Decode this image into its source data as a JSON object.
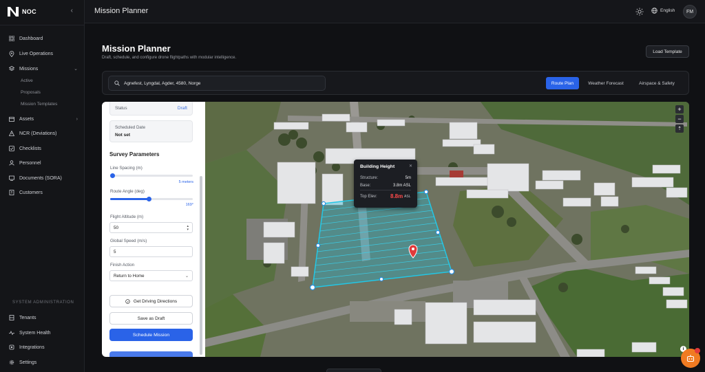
{
  "brand": {
    "name": "NOC"
  },
  "sidebar": {
    "items": [
      {
        "label": "Dashboard",
        "icon": "grid-icon"
      },
      {
        "label": "Live Operations",
        "icon": "map-pin-icon"
      },
      {
        "label": "Missions",
        "icon": "layers-icon"
      },
      {
        "label": "Assets",
        "icon": "box-icon"
      },
      {
        "label": "NCR (Deviations)",
        "icon": "alert-icon"
      },
      {
        "label": "Checklists",
        "icon": "checklist-icon"
      },
      {
        "label": "Personnel",
        "icon": "user-icon"
      },
      {
        "label": "Documents (SORA)",
        "icon": "document-icon"
      },
      {
        "label": "Customers",
        "icon": "building-icon"
      }
    ],
    "missions_sub": [
      "Active",
      "Proposals",
      "Mission Templates"
    ],
    "admin_title": "SYSTEM ADMINISTRATION",
    "admin_items": [
      {
        "label": "Tenants",
        "icon": "tenants-icon"
      },
      {
        "label": "System Health",
        "icon": "pulse-icon"
      },
      {
        "label": "Integrations",
        "icon": "plug-icon"
      },
      {
        "label": "Settings",
        "icon": "gear-icon"
      }
    ]
  },
  "topbar": {
    "title": "Mission Planner",
    "language": "English",
    "avatar": "FM"
  },
  "page": {
    "title": "Mission Planner",
    "subtitle": "Draft, schedule, and configure drone flightpaths with modular intelligence.",
    "load_template": "Load Template"
  },
  "search": {
    "value": "Agnefest, Lyngdal, Agder, 4580, Norge"
  },
  "tabs": [
    "Route Plan",
    "Weather Forecast",
    "Airspace & Safety"
  ],
  "panel": {
    "status_label": "Status",
    "status_value": "Draft",
    "scheduled_label": "Scheduled Date",
    "scheduled_value": "Not set",
    "section_title": "Survey Parameters",
    "line_spacing_label": "Line Spacing (m)",
    "line_spacing_value": "5 meters",
    "route_angle_label": "Route Angle (deg)",
    "route_angle_value": "169°",
    "flight_altitude_label": "Flight Altitude (m)",
    "flight_altitude_value": "50",
    "global_speed_label": "Global Speed (m/s)",
    "global_speed_value": "5",
    "finish_action_label": "Finish Action",
    "finish_action_value": "Return to Home",
    "driving_btn": "Get Driving Directions",
    "save_draft_btn": "Save as Draft",
    "schedule_btn": "Schedule Mission"
  },
  "sliders": {
    "line_spacing_fraction": 0.0,
    "route_angle_fraction": 0.47
  },
  "tooltip": {
    "title": "Building Height",
    "structure_label": "Structure:",
    "structure_value": "5m",
    "base_label": "Base:",
    "base_value": "3.8m ASL",
    "top_label": "Top Elev:",
    "top_value": "8.8m",
    "top_unit": "ASL"
  },
  "map_controls": {
    "zoom_in": "+",
    "zoom_out": "−",
    "compass": "⇡"
  },
  "colors": {
    "accent": "#2a63e8",
    "survey_area": "#1fb8d6",
    "pin": "#e23a3a",
    "assistant": "#f07b22"
  }
}
